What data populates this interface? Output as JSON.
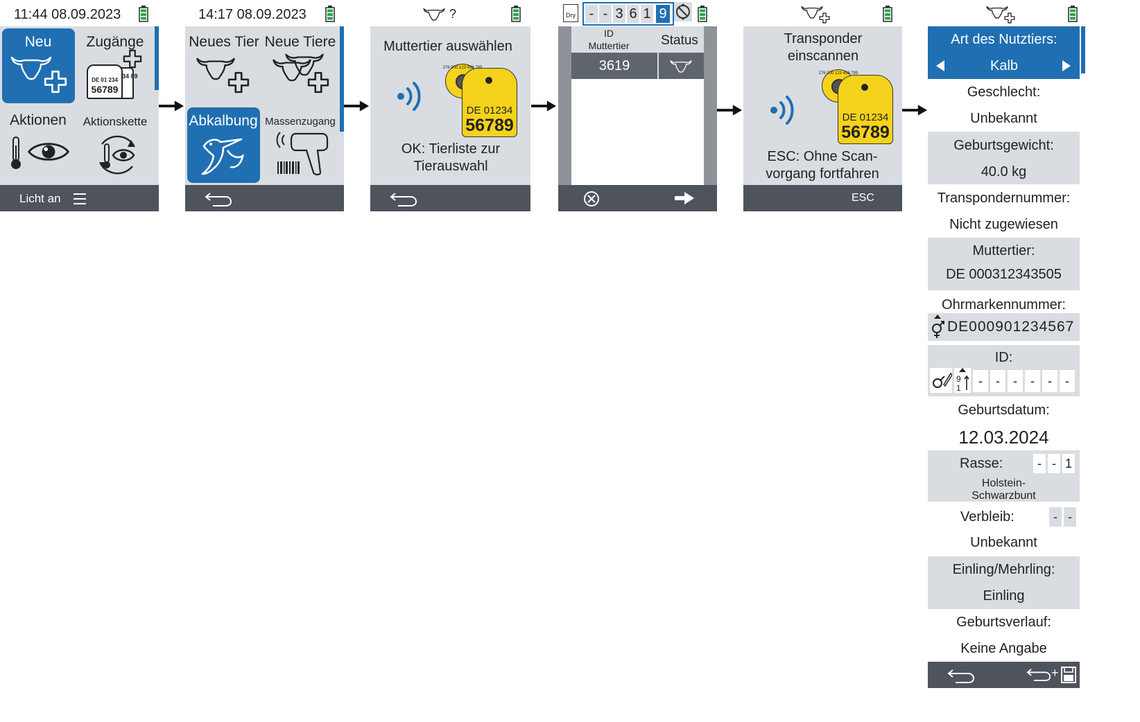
{
  "colors": {
    "accent": "#1f6fb2",
    "panel": "#d9dde1",
    "footer": "#4e535c",
    "tag_yellow": "#f5d21b",
    "battery": "#27a84a"
  },
  "screen1": {
    "datetime": "11:44 08.09.2023",
    "tiles": [
      {
        "label": "Neu",
        "icon": "cow-plus-icon",
        "selected": true
      },
      {
        "label": "Zugänge",
        "icon": "ear-tags-plus-icon",
        "tag_line1": "DE 01 234",
        "tag_number": "56789",
        "tag_back": "234 89"
      },
      {
        "label": "Aktionen",
        "icon": "thermometer-eye-icon"
      },
      {
        "label": "Aktionskette",
        "icon": "thermometer-eye-cycle-icon"
      }
    ],
    "footer_text": "Licht an",
    "footer_icon": "menu-icon"
  },
  "screen2": {
    "datetime": "14:17 08.09.2023",
    "tiles": [
      {
        "label": "Neues Tier",
        "icon": "cow-plus-icon"
      },
      {
        "label": "Neue Tiere",
        "icon": "cows-plus-icon"
      },
      {
        "label": "Abkalbung",
        "icon": "stork-icon",
        "selected": true
      },
      {
        "label": "Massenzugang",
        "icon": "barcode-scanner-icon"
      }
    ],
    "footer_icon": "back-icon"
  },
  "screen3": {
    "header_icon": "cow-head-icon",
    "header_suffix": "?",
    "title": "Muttertier auswählen",
    "tag_line1": "DE 01234",
    "tag_number": "56789",
    "button_tag_text": "276 000 123 456 789",
    "hint_line1": "OK: Tierliste zur",
    "hint_line2": "Tierauswahl",
    "footer_icon": "back-icon"
  },
  "screen4": {
    "dry_label": "Dry",
    "digits": [
      "-",
      "-",
      "3",
      "6",
      "1",
      "9"
    ],
    "col_id_line1": "ID",
    "col_id_line2": "Muttertier",
    "col_status": "Status",
    "rows": [
      {
        "id": "3619",
        "status_icon": "cow-head-icon"
      }
    ],
    "footer_left_icon": "cancel-icon",
    "footer_right_icon": "arrow-right-icon"
  },
  "screen5": {
    "header_icon": "cow-plus-icon",
    "title_line1": "Transponder",
    "title_line2": "einscannen",
    "tag_line1": "DE 01234",
    "tag_number": "56789",
    "button_tag_text": "276 000 123 456 789",
    "hint_line1": "ESC: Ohne Scan-",
    "hint_line2": "vorgang fortfahren",
    "footer_text": "ESC"
  },
  "screen6": {
    "header_icon": "cow-plus-icon",
    "art_label": "Art des Nutztiers:",
    "art_value": "Kalb",
    "geschlecht_label": "Geschlecht:",
    "geschlecht_value": "Unbekannt",
    "gewicht_label": "Geburtsgewicht:",
    "gewicht_value": "40.0 kg",
    "transponder_label": "Transpondernummer:",
    "transponder_value": "Nicht zugewiesen",
    "mutter_label": "Muttertier:",
    "mutter_value": "DE 000312343505",
    "ohrmarke_label": "Ohrmarkennummer:",
    "ohrmarke_value": "DE000901234567",
    "id_label": "ID:",
    "id_digits": [
      "-",
      "-",
      "-",
      "-",
      "-",
      "-"
    ],
    "geburtsdatum_label": "Geburtsdatum:",
    "geburtsdatum_value": "12.03.2024",
    "rasse_label": "Rasse:",
    "rasse_digits": [
      "-",
      "-",
      "1"
    ],
    "rasse_value_line1": "Holstein-",
    "rasse_value_line2": "Schwarzbunt",
    "verbleib_label": "Verbleib:",
    "verbleib_digits": [
      "-",
      "-"
    ],
    "verbleib_value": "Unbekannt",
    "einling_label": "Einling/Mehrling:",
    "einling_value": "Einling",
    "geburtsverlauf_label": "Geburtsverlauf:",
    "geburtsverlauf_value": "Keine Angabe",
    "footer_left_icon": "back-icon",
    "footer_right_icon": "back-save-icon"
  }
}
